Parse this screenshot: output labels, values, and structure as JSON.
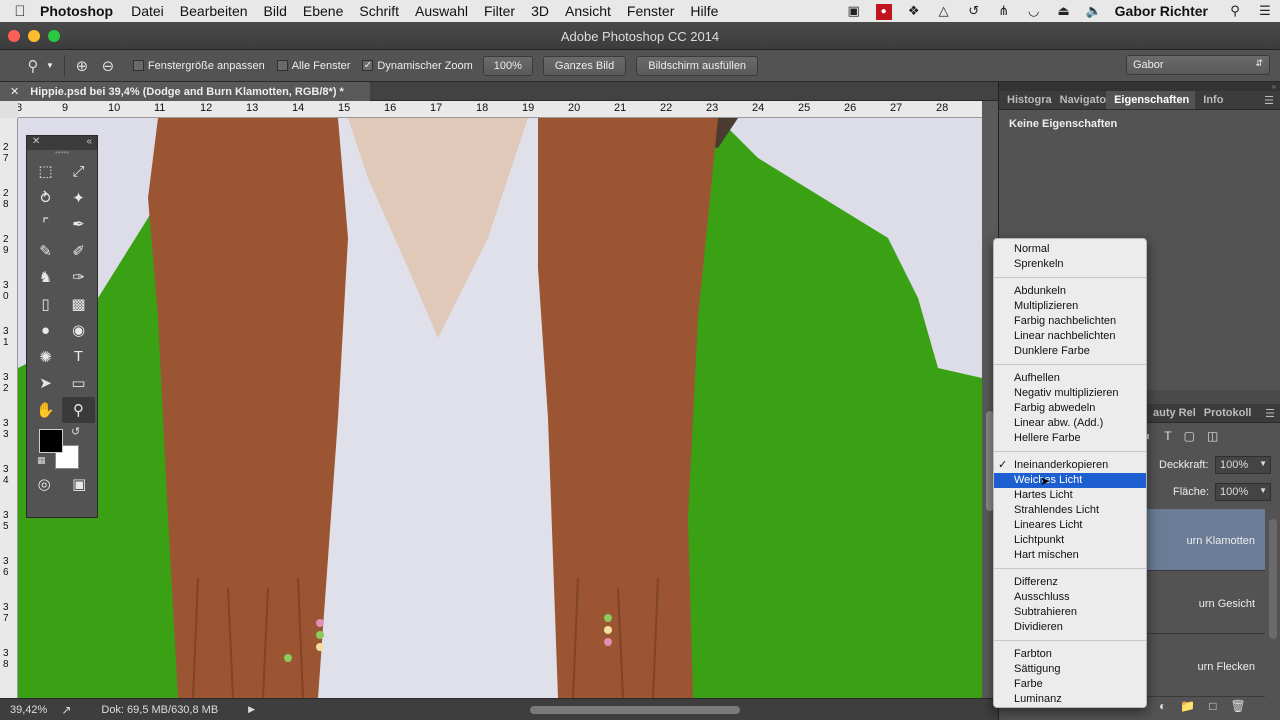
{
  "menubar": {
    "app": "Photoshop",
    "items": [
      "Datei",
      "Bearbeiten",
      "Bild",
      "Ebene",
      "Schrift",
      "Auswahl",
      "Filter",
      "3D",
      "Ansicht",
      "Fenster",
      "Hilfe"
    ],
    "user": "Gabor Richter"
  },
  "window": {
    "title": "Adobe Photoshop CC 2014"
  },
  "options": {
    "fit_window": "Fenstergröße anpassen",
    "all_windows": "Alle Fenster",
    "dynamic_zoom": "Dynamischer Zoom",
    "zoom_100": "100%",
    "whole_image": "Ganzes Bild",
    "fill_screen": "Bildschirm ausfüllen",
    "workspace": "Gabor"
  },
  "document": {
    "tab_title": "Hippie.psd bei 39,4% (Dodge and Burn Klamotten, RGB/8*) *",
    "ruler_h": [
      "8",
      "9",
      "10",
      "11",
      "12",
      "13",
      "14",
      "15",
      "16",
      "17",
      "18",
      "19",
      "20",
      "21",
      "22",
      "23",
      "24",
      "25",
      "26",
      "27",
      "28"
    ],
    "ruler_v": [
      "2\n7",
      "2\n8",
      "2\n9",
      "3\n0",
      "3\n1",
      "3\n2",
      "3\n3",
      "3\n4",
      "3\n5",
      "3\n6",
      "3\n7",
      "3\n8"
    ]
  },
  "status": {
    "zoom": "39,42%",
    "doc_size": "Dok: 69,5 MB/630,8 MB"
  },
  "panels": {
    "top_tabs": [
      "Histogra",
      "Navigato",
      "Eigenschaften",
      "Info"
    ],
    "properties_text": "Keine Eigenschaften",
    "layer_tabs": [
      "auty Rel",
      "Protokoll"
    ],
    "opacity_label": "Deckkraft:",
    "opacity_value": "100%",
    "fill_label": "Fläche:",
    "fill_value": "100%",
    "layers": [
      "urn Klamotten",
      "urn Gesicht",
      "urn Flecken"
    ]
  },
  "blend_modes": {
    "groups": [
      [
        "Normal",
        "Sprenkeln"
      ],
      [
        "Abdunkeln",
        "Multiplizieren",
        "Farbig nachbelichten",
        "Linear nachbelichten",
        "Dunklere Farbe"
      ],
      [
        "Aufhellen",
        "Negativ multiplizieren",
        "Farbig abwedeln",
        "Linear abw. (Add.)",
        "Hellere Farbe"
      ],
      [
        "Ineinanderkopieren",
        "Weiches Licht",
        "Hartes Licht",
        "Strahlendes Licht",
        "Lineares Licht",
        "Lichtpunkt",
        "Hart mischen"
      ],
      [
        "Differenz",
        "Ausschluss",
        "Subtrahieren",
        "Dividieren"
      ],
      [
        "Farbton",
        "Sättigung",
        "Farbe",
        "Luminanz"
      ]
    ],
    "checked": "Ineinanderkopieren",
    "highlighted": "Weiches Licht"
  },
  "colors": {
    "foreground": "#000000",
    "background": "#ffffff",
    "green_screen": "#3aa014",
    "vest": "#9c5532",
    "selection": "#1d5fd0"
  }
}
